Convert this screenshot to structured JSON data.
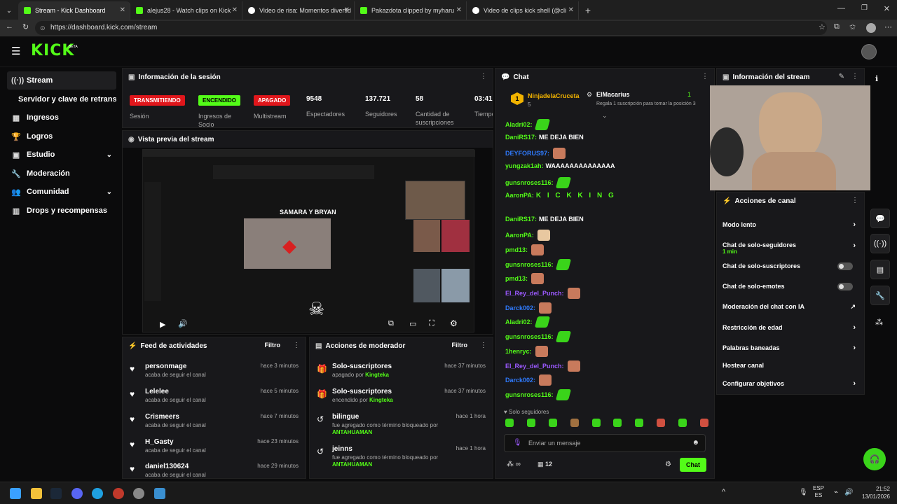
{
  "browser": {
    "tabs": [
      {
        "title": "Stream - Kick Dashboard",
        "color": "#53fc18"
      },
      {
        "title": "alejus28 - Watch clips on Kick",
        "color": "#53fc18"
      },
      {
        "title": "Video de risa: Momentos divertid",
        "color": "#fff"
      },
      {
        "title": "Pakazdota clipped by myharu",
        "color": "#53fc18"
      },
      {
        "title": "Video de clips kick shell (@cli",
        "color": "#fff"
      }
    ],
    "url": "https://dashboard.kick.com/stream"
  },
  "kick": {
    "logo": "KICK",
    "beta": "BETA"
  },
  "sidebar": {
    "items": [
      {
        "label": "Stream",
        "icon": "stream-icon"
      },
      {
        "label": "Servidor y clave de retransmisión"
      },
      {
        "label": "Ingresos",
        "icon": "revenue-icon"
      },
      {
        "label": "Logros",
        "icon": "achievements-icon"
      },
      {
        "label": "Estudio",
        "icon": "studio-icon"
      },
      {
        "label": "Moderación",
        "icon": "moderation-icon"
      },
      {
        "label": "Comunidad",
        "icon": "community-icon"
      },
      {
        "label": "Drops y recompensas",
        "icon": "drops-icon"
      }
    ]
  },
  "session": {
    "title": "Información de la sesión",
    "badges": [
      {
        "text": "TRANSMITIENDO",
        "label": "Sesión",
        "bg": "#e0161b",
        "fg": "#fff"
      },
      {
        "text": "ENCENDIDO",
        "label": "Ingresos de Socio",
        "bg": "#53fc18",
        "fg": "#000"
      },
      {
        "text": "APAGADO",
        "label": "Multistream",
        "bg": "#e0161b",
        "fg": "#fff"
      }
    ],
    "stats": [
      {
        "value": "9548",
        "label": "Espectadores"
      },
      {
        "value": "137.721",
        "label": "Seguidores"
      },
      {
        "value": "58",
        "label": "Cantidad de suscripciones"
      },
      {
        "value": "03:41",
        "label": "Tiempo en vivo"
      }
    ]
  },
  "preview": {
    "title": "Vista previa del stream",
    "overlay_title": "SAMARA Y BRYAN"
  },
  "activity": {
    "title": "Feed de actividades",
    "filter": "Filtro",
    "items": [
      {
        "name": "personmage",
        "sub": "acaba de seguir el canal",
        "time": "hace 3 minutos"
      },
      {
        "name": "Lelelee",
        "sub": "acaba de seguir el canal",
        "time": "hace 5 minutos"
      },
      {
        "name": "Crismeers",
        "sub": "acaba de seguir el canal",
        "time": "hace 7 minutos"
      },
      {
        "name": "H_Gasty",
        "sub": "acaba de seguir el canal",
        "time": "hace 23 minutos"
      },
      {
        "name": "daniel130624",
        "sub": "acaba de seguir el canal",
        "time": "hace 29 minutos"
      }
    ]
  },
  "modactions": {
    "title": "Acciones de moderador",
    "filter": "Filtro",
    "items": [
      {
        "name": "Solo-suscriptores",
        "pre": "apagado por",
        "by": "Kingteka",
        "time": "hace 37 minutos",
        "icon": "gift-icon"
      },
      {
        "name": "Solo-suscriptores",
        "pre": "encendido por",
        "by": "Kingteka",
        "time": "hace 37 minutos",
        "icon": "gift-icon"
      },
      {
        "name": "bilingue",
        "pre": "fue agregado como término bloqueado por",
        "by": "ANTAHUAMAN",
        "time": "hace 1 hora",
        "icon": "history-icon"
      },
      {
        "name": "jeinns",
        "pre": "fue agregado como término bloqueado por",
        "by": "ANTAHUAMAN",
        "time": "hace 1 hora",
        "icon": "history-icon"
      }
    ]
  },
  "chat": {
    "title": "Chat",
    "pinned": [
      {
        "name": "NinjadelaCruceta",
        "count": "5"
      },
      {
        "name": "ElMacarius",
        "count": "1",
        "note": "Regala 1 suscripción para tomar la posición 3"
      }
    ],
    "messages": [
      {
        "user": "Aladri02:",
        "color": "#53fc18",
        "text": "",
        "emote": "green"
      },
      {
        "user": "DaniRS17:",
        "color": "#53fc18",
        "text": "ME DEJA BIEN",
        "emote": ""
      },
      {
        "user": "DEYFORUS97:",
        "color": "#2f7bff",
        "text": "",
        "emote": "face"
      },
      {
        "user": "yungzak1ah:",
        "color": "#53fc18",
        "text": "WAAAAAAAAAAAAAA",
        "emote": ""
      },
      {
        "user": "gunsnroses116:",
        "color": "#53fc18",
        "text": "",
        "emote": "green"
      },
      {
        "user": "AaronPA:",
        "color": "#53fc18",
        "text": "K I C K  K I N G",
        "emote": ""
      },
      {
        "user": "DaniRS17:",
        "color": "#53fc18",
        "text": "ME DEJA BIEN",
        "emote": ""
      },
      {
        "user": "AaronPA:",
        "color": "#53fc18",
        "text": "",
        "emote": "pale"
      },
      {
        "user": "pmd13:",
        "color": "#53fc18",
        "text": "",
        "emote": "face"
      },
      {
        "user": "gunsnroses116:",
        "color": "#53fc18",
        "text": "",
        "emote": "green"
      },
      {
        "user": "pmd13:",
        "color": "#53fc18",
        "text": "",
        "emote": "face"
      },
      {
        "user": "El_Rey_del_Punch:",
        "color": "#9b59ff",
        "text": "",
        "emote": "face"
      },
      {
        "user": "Darck002:",
        "color": "#2f7bff",
        "text": "",
        "emote": "face"
      },
      {
        "user": "Aladri02:",
        "color": "#53fc18",
        "text": "",
        "emote": "green"
      },
      {
        "user": "gunsnroses116:",
        "color": "#53fc18",
        "text": "",
        "emote": "green"
      },
      {
        "user": "1henryc:",
        "color": "#53fc18",
        "text": "",
        "emote": "face"
      },
      {
        "user": "El_Rey_del_Punch:",
        "color": "#9b59ff",
        "text": "",
        "emote": "face"
      },
      {
        "user": "Darck002:",
        "color": "#2f7bff",
        "text": "",
        "emote": "face"
      },
      {
        "user": "gunsnroses116:",
        "color": "#53fc18",
        "text": "",
        "emote": "green"
      }
    ],
    "mode_label": "Solo seguidores",
    "input_placeholder": "Enviar un mensaje",
    "viewers": "12",
    "send": "Chat"
  },
  "streaminfo": {
    "title": "Información del stream"
  },
  "channelactions": {
    "title": "Acciones de canal",
    "items": [
      {
        "label": "Modo lento",
        "sub": "",
        "control": "chevron"
      },
      {
        "label": "Chat de solo-seguidores",
        "sub": "1 min",
        "control": "chevron"
      },
      {
        "label": "Chat de solo-suscriptores",
        "sub": "",
        "control": "toggle"
      },
      {
        "label": "Chat de solo-emotes",
        "sub": "",
        "control": "toggle"
      },
      {
        "label": "Moderación del chat con IA",
        "sub": "",
        "control": "external"
      },
      {
        "label": "Restricción de edad",
        "sub": "",
        "control": "chevron"
      },
      {
        "label": "Palabras baneadas",
        "sub": "",
        "control": "chevron"
      },
      {
        "label": "Hostear canal",
        "sub": "",
        "control": "none"
      },
      {
        "label": "Configurar objetivos",
        "sub": "",
        "control": "chevron"
      }
    ]
  },
  "taskbar": {
    "lang": "ESP",
    "lang2": "ES",
    "time": "21:52",
    "date": "13/01/2026"
  }
}
